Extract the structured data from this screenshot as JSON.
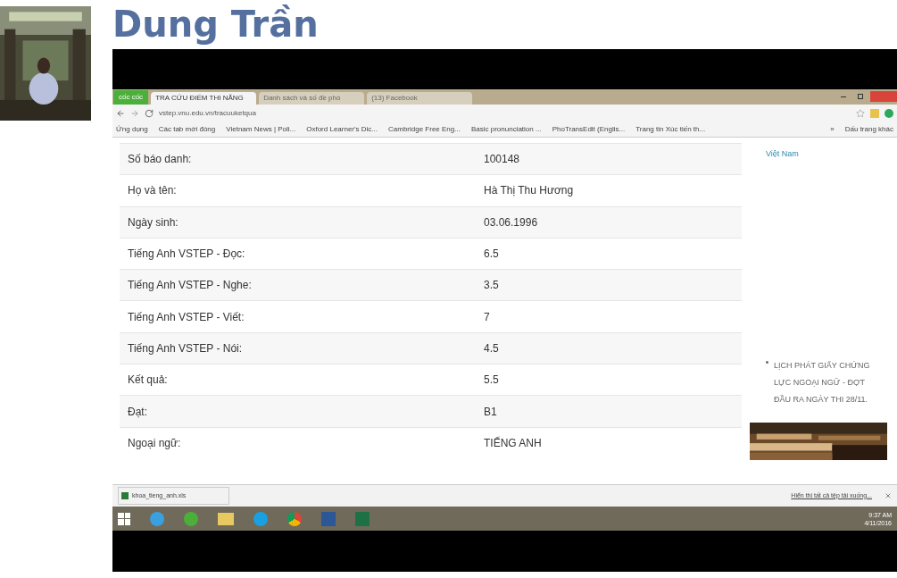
{
  "post": {
    "author": "Dung Trần"
  },
  "browser": {
    "logo": "cốc cốc",
    "tabs": [
      {
        "label": "TRA CỨU ĐIỂM THI NĂNG",
        "selected": true
      },
      {
        "label": "Danh sách và số đề phò",
        "selected": false
      },
      {
        "label": "(13) Facebook",
        "selected": false
      }
    ],
    "address": "vstep.vnu.edu.vn/tracuuketqua",
    "bookmarks": [
      "Ứng dụng",
      "Các tab mới đóng",
      "Vietnam News | Poli...",
      "Oxford Learner's Dic...",
      "Cambridge Free Eng...",
      "Basic pronunciation ...",
      "PhoTransEdit (Englis...",
      "Trang tin Xúc tiến th..."
    ],
    "bookmarks_more": "»",
    "other_bookmarks": "Dấu trang khác"
  },
  "results": [
    {
      "label": "Số báo danh:",
      "value": "100148"
    },
    {
      "label": "Họ và tên:",
      "value": "Hà Thị Thu Hương"
    },
    {
      "label": "Ngày sinh:",
      "value": "03.06.1996"
    },
    {
      "label": "Tiếng Anh VSTEP - Đọc:",
      "value": "6.5"
    },
    {
      "label": "Tiếng Anh VSTEP - Nghe:",
      "value": "3.5"
    },
    {
      "label": "Tiếng Anh VSTEP - Viết:",
      "value": "7"
    },
    {
      "label": "Tiếng Anh VSTEP - Nói:",
      "value": "4.5"
    },
    {
      "label": "Kết quả:",
      "value": "5.5"
    },
    {
      "label": "Đạt:",
      "value": "B1"
    },
    {
      "label": "Ngoại ngữ:",
      "value": "TIẾNG ANH"
    }
  ],
  "sidebar": {
    "link": "Việt Nam",
    "news": [
      "LỊCH PHÁT GIẤY CHỨNG",
      "LỰC NGOẠI NGỮ - ĐỢT",
      "ĐẦU RA NGÀY THI 28/11."
    ]
  },
  "download_bar": {
    "file": "khoa_tieng_anh.xls",
    "show_all": "Hiển thị tất cả tệp tải xuống..."
  },
  "taskbar": {
    "time": "9:37 AM",
    "date": "4/11/2016"
  }
}
